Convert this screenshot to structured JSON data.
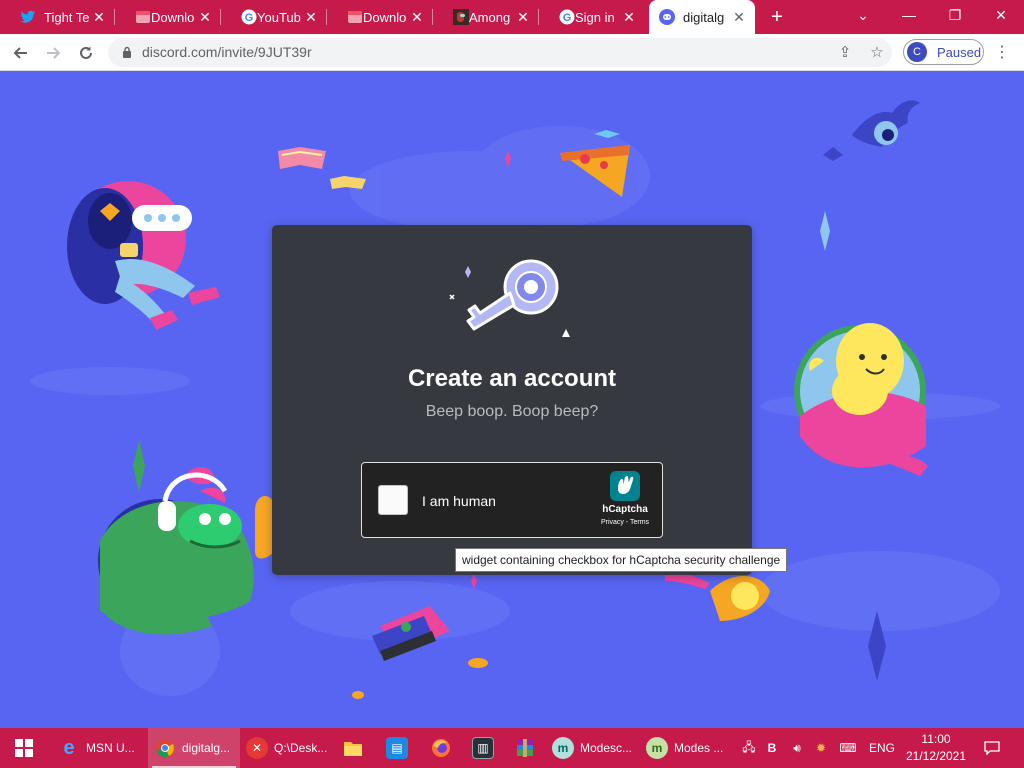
{
  "browser": {
    "tabs": [
      {
        "title": "Tight Te",
        "icon": "twitter-icon",
        "color": "#1da1f2",
        "active": false
      },
      {
        "title": "Downlo",
        "icon": "download-site-icon",
        "color": "#e9546b",
        "active": false
      },
      {
        "title": "YouTub",
        "icon": "google-icon",
        "color": "#4285f4",
        "active": false
      },
      {
        "title": "Downlo",
        "icon": "download-site-icon",
        "color": "#e9546b",
        "active": false
      },
      {
        "title": "Among",
        "icon": "among-us-icon",
        "color": "#6b3a2a",
        "active": false
      },
      {
        "title": "Sign in",
        "icon": "google-icon",
        "color": "#4285f4",
        "active": false
      },
      {
        "title": "digitalg",
        "icon": "discord-icon",
        "color": "#5865f2",
        "active": true
      }
    ],
    "url": "discord.com/invite/9JUT39r",
    "profile": {
      "initial": "C",
      "status": "Paused"
    }
  },
  "page": {
    "title": "Create an account",
    "subtitle": "Beep boop. Boop beep?",
    "captcha": {
      "label": "I am human",
      "brand": "hCaptcha",
      "terms": "Privacy - Terms",
      "checked": false
    },
    "tooltip": "widget containing checkbox for hCaptcha security challenge"
  },
  "taskbar": {
    "items": [
      {
        "label": "MSN U...",
        "icon": "internet-explorer-icon"
      },
      {
        "label": "digitalg...",
        "icon": "chrome-icon",
        "active": true
      },
      {
        "label": "Q:\\Desk...",
        "icon": "app-x-icon"
      },
      {
        "label": "",
        "icon": "file-explorer-icon"
      },
      {
        "label": "",
        "icon": "outlook-icon"
      },
      {
        "label": "",
        "icon": "firefox-icon"
      },
      {
        "label": "",
        "icon": "terminal-icon"
      },
      {
        "label": "",
        "icon": "winrar-icon"
      },
      {
        "label": "Modesc...",
        "icon": "modes-icon"
      },
      {
        "label": "Modes ...",
        "icon": "modes-icon"
      }
    ],
    "tray": {
      "lang": "ENG",
      "b_label": "B",
      "time": "11:00",
      "date": "21/12/2021"
    }
  },
  "colors": {
    "chrome_frame": "#c51a4a",
    "discord_blurple": "#5865f2",
    "card_bg": "#36393f",
    "hcaptcha_teal": "#00838f"
  }
}
